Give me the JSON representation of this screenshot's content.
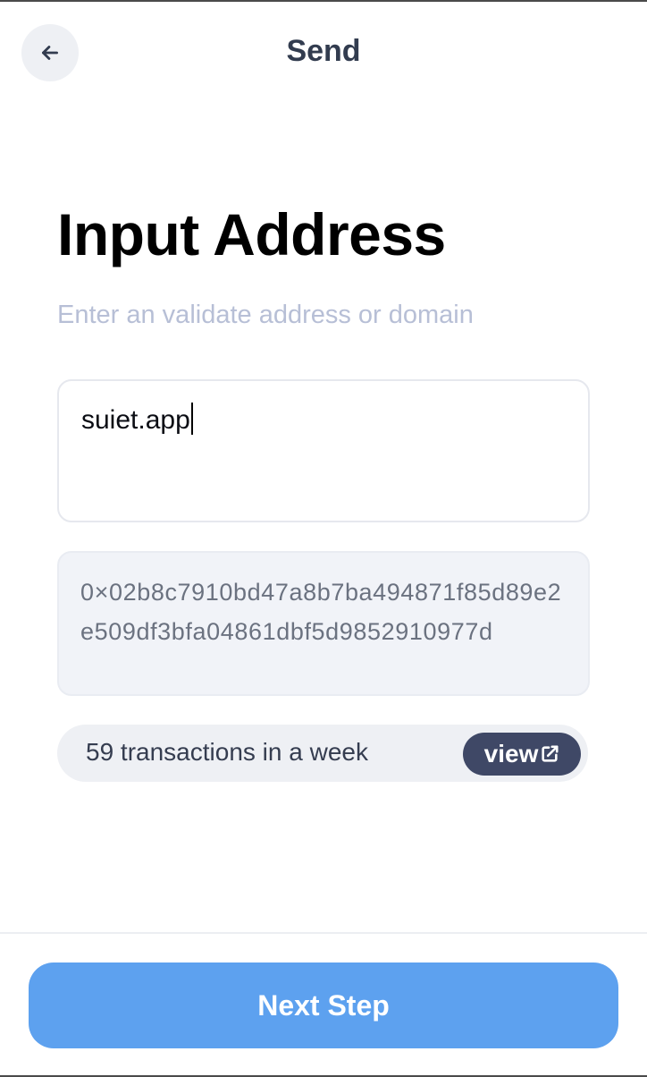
{
  "header": {
    "title": "Send",
    "back_icon": "arrow-left-icon"
  },
  "main": {
    "title": "Input Address",
    "subtitle": "Enter an validate address or domain",
    "address_input": {
      "value": "suiet.app",
      "placeholder": ""
    },
    "resolved_address": "0×02b8c7910bd47a8b7ba494871f85d89e2e509df3bfa04861dbf5d9852910977d",
    "transactions": {
      "text": "59 transactions in a week",
      "view_label": "view",
      "view_icon": "external-link-icon"
    }
  },
  "footer": {
    "next_label": "Next Step"
  },
  "colors": {
    "accent": "#5da1ef",
    "dark_pill": "#3f4866",
    "subtitle": "#b7bfd6"
  }
}
